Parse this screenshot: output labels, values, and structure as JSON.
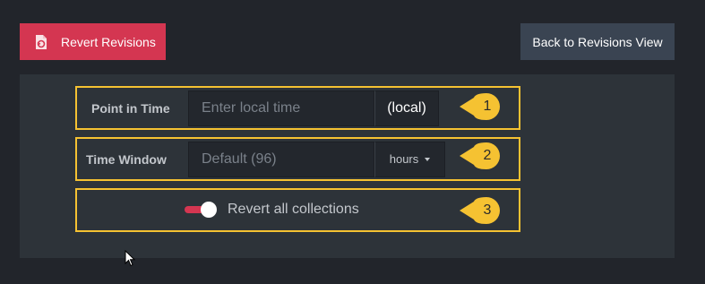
{
  "header": {
    "revert_button_label": "Revert Revisions",
    "revert_icon": "file-revert-icon",
    "back_button_label": "Back to Revisions View"
  },
  "form": {
    "point_in_time": {
      "label": "Point in Time",
      "placeholder": "Enter local time",
      "addon": "(local)"
    },
    "time_window": {
      "label": "Time Window",
      "placeholder": "Default (96)",
      "unit_selected": "hours"
    },
    "revert_all": {
      "label": "Revert all collections",
      "enabled": true
    }
  },
  "callouts": [
    "1",
    "2",
    "3"
  ],
  "colors": {
    "accent": "#d43651",
    "highlight": "#f5c232",
    "secondary": "#3a4452",
    "panel": "#2d3339",
    "background": "#22252b"
  }
}
